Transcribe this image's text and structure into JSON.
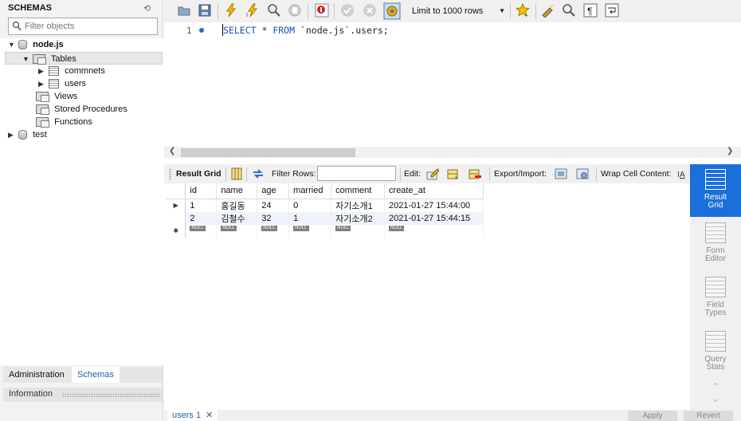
{
  "sidebar": {
    "title": "SCHEMAS",
    "filter_placeholder": "Filter objects",
    "tree": {
      "db1": "node.js",
      "tables": "Tables",
      "table1": "commnets",
      "table2": "users",
      "views": "Views",
      "procedures": "Stored Procedures",
      "functions": "Functions",
      "db2": "test"
    },
    "tabs": {
      "administration": "Administration",
      "schemas": "Schemas"
    },
    "info_label": "Information"
  },
  "toolbar": {
    "limit": "Limit to 1000 rows"
  },
  "editor": {
    "line_number": "1",
    "sql": {
      "select": "SELECT",
      "star": " * ",
      "from": "FROM",
      "rest": " `node.js`.users;"
    }
  },
  "result_toolbar": {
    "result_grid": "Result Grid",
    "filter_rows": "Filter Rows:",
    "edit": "Edit:",
    "export_import": "Export/Import:",
    "wrap": "Wrap Cell Content:"
  },
  "grid": {
    "columns": [
      "id",
      "name",
      "age",
      "married",
      "comment",
      "create_at"
    ],
    "rows": [
      [
        "1",
        "홍길동",
        "24",
        "0",
        "자기소개1",
        "2021-01-27 15:44:00"
      ],
      [
        "2",
        "김철수",
        "32",
        "1",
        "자기소개2",
        "2021-01-27 15:44:15"
      ]
    ],
    "null_label": "NULL"
  },
  "side_panel": {
    "result_grid_1": "Result",
    "result_grid_2": "Grid",
    "form_editor_1": "Form",
    "form_editor_2": "Editor",
    "field_types_1": "Field",
    "field_types_2": "Types",
    "query_stats_1": "Query",
    "query_stats_2": "Stats"
  },
  "bottom": {
    "tab": "users 1",
    "apply": "Apply",
    "revert": "Revert"
  }
}
